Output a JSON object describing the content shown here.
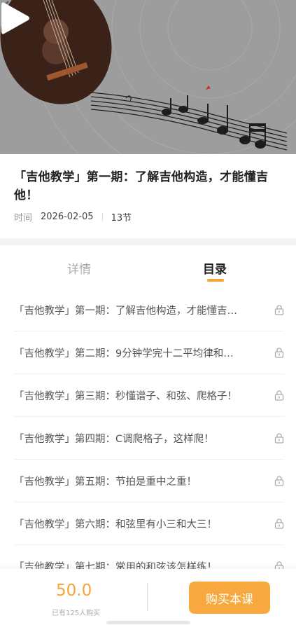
{
  "video": {
    "play_icon": "play-icon",
    "back_icon": "back-arrow-icon"
  },
  "course": {
    "title": "「吉他教学」第一期：了解吉他构造，才能懂吉他！",
    "time_label": "时间",
    "date": "2026-02-05",
    "lesson_count": "13节"
  },
  "tabs": {
    "detail": "详情",
    "catalog": "目录",
    "active": "catalog"
  },
  "lessons": [
    "「吉他教学」第一期：了解吉他构造，才能懂吉…",
    "「吉他教学」第二期：9分钟学完十二平均律和…",
    "「吉他教学」第三期：秒懂谱子、和弦、爬格子！",
    "「吉他教学」第四期：C调爬格子，这样爬！",
    "「吉他教学」第五期：节拍是重中之重！",
    "「吉他教学」第六期：和弦里有小三和大三！",
    "「吉他教学」第七期：常用的和弦该怎样练！"
  ],
  "lock_icon": "lock-icon",
  "purchase": {
    "price": "50.0",
    "buyers": "已有125人购买",
    "buy_label": "购买本课"
  },
  "colors": {
    "accent": "#f7a33a",
    "hero_bg": "#9c9c9c"
  }
}
